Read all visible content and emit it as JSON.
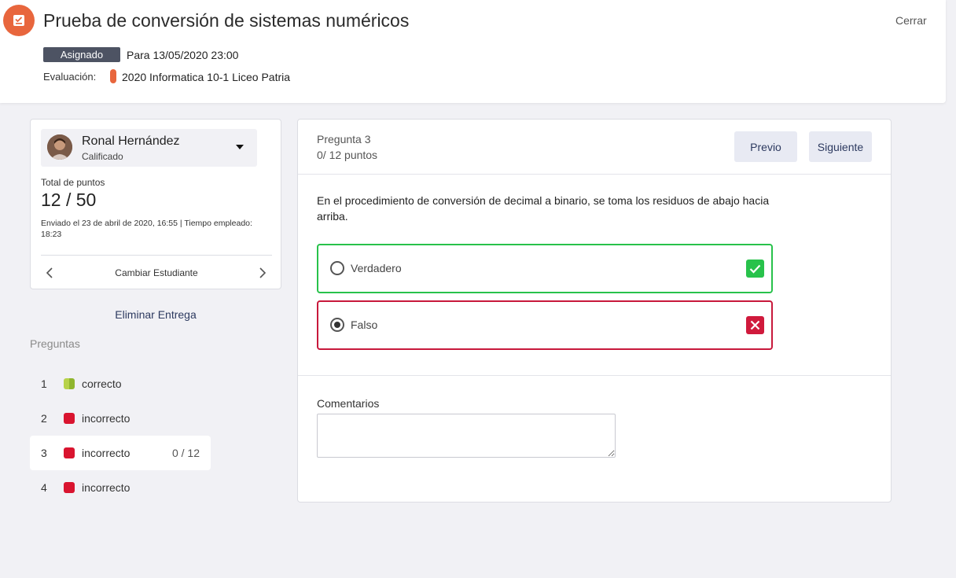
{
  "header": {
    "title": "Prueba de conversión de sistemas numéricos",
    "close_label": "Cerrar",
    "status_badge": "Asignado",
    "due_date": "Para 13/05/2020 23:00",
    "evaluation_label": "Evaluación:",
    "class_name": "2020 Informatica 10-1 Liceo Patria",
    "accent_color": "#e8663d",
    "app_icon": "assignment-icon"
  },
  "student": {
    "name": "Ronal Hernández",
    "status": "Calificado",
    "points_label": "Total de puntos",
    "points_value": "12 / 50",
    "submitted_info": "Enviado el 23 de abril de 2020, 16:55 | Tiempo empleado: 18:23",
    "change_label": "Cambiar Estudiante",
    "prev_icon": "chevron-left-icon",
    "next_icon": "chevron-right-icon",
    "dropdown_icon": "caret-down-icon"
  },
  "sidebar": {
    "delete_label": "Eliminar Entrega",
    "questions_heading": "Preguntas",
    "questions": [
      {
        "number": "1",
        "status": "correcto",
        "color": "#9cc23b",
        "score": ""
      },
      {
        "number": "2",
        "status": "incorrecto",
        "color": "#d9142f",
        "score": ""
      },
      {
        "number": "3",
        "status": "incorrecto",
        "color": "#d9142f",
        "score": "0 / 12"
      },
      {
        "number": "4",
        "status": "incorrecto",
        "color": "#d9142f",
        "score": ""
      }
    ]
  },
  "question": {
    "title": "Pregunta 3",
    "points": "0/ 12 puntos",
    "prev_label": "Previo",
    "next_label": "Siguiente",
    "text": "En el procedimiento de conversión de decimal a binario, se toma los residuos de abajo hacia arriba.",
    "options": [
      {
        "label": "Verdadero",
        "selected": false,
        "result": "correct",
        "color": "#28c24b",
        "icon": "check-icon"
      },
      {
        "label": "Falso",
        "selected": true,
        "result": "incorrect",
        "color": "#c8193c",
        "icon": "cross-icon"
      }
    ],
    "comments_label": "Comentarios",
    "comments_value": ""
  }
}
